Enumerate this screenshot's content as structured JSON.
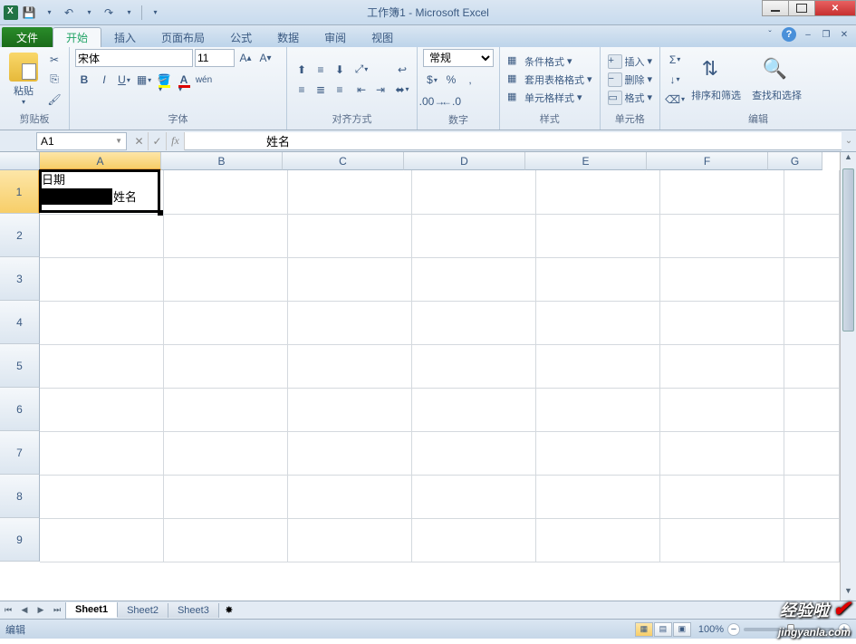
{
  "title": "工作簿1 - Microsoft Excel",
  "tabs": {
    "file": "文件",
    "home": "开始",
    "insert": "插入",
    "layout": "页面布局",
    "formulas": "公式",
    "data": "数据",
    "review": "审阅",
    "view": "视图"
  },
  "ribbon": {
    "clipboard": {
      "label": "剪贴板",
      "paste": "粘贴"
    },
    "font": {
      "label": "字体",
      "name": "宋体",
      "size": "11"
    },
    "alignment": {
      "label": "对齐方式"
    },
    "number": {
      "label": "数字",
      "format": "常规"
    },
    "styles": {
      "label": "样式",
      "cond": "条件格式",
      "table": "套用表格格式",
      "cell": "单元格样式"
    },
    "cells": {
      "label": "单元格",
      "insert": "插入",
      "delete": "删除",
      "format": "格式"
    },
    "editing": {
      "label": "编辑",
      "sort": "排序和筛选",
      "find": "查找和选择"
    }
  },
  "namebox": "A1",
  "formula": "姓名",
  "columns": [
    "A",
    "B",
    "C",
    "D",
    "E",
    "F",
    "G"
  ],
  "rows": [
    "1",
    "2",
    "3",
    "4",
    "5",
    "6",
    "7",
    "8",
    "9"
  ],
  "cellA1": {
    "top": "日期",
    "bottom": "姓名"
  },
  "sheets": {
    "s1": "Sheet1",
    "s2": "Sheet2",
    "s3": "Sheet3"
  },
  "status": "编辑",
  "zoom": "100%",
  "watermark": {
    "brand": "经验啦",
    "url": "jingyanla.com"
  }
}
